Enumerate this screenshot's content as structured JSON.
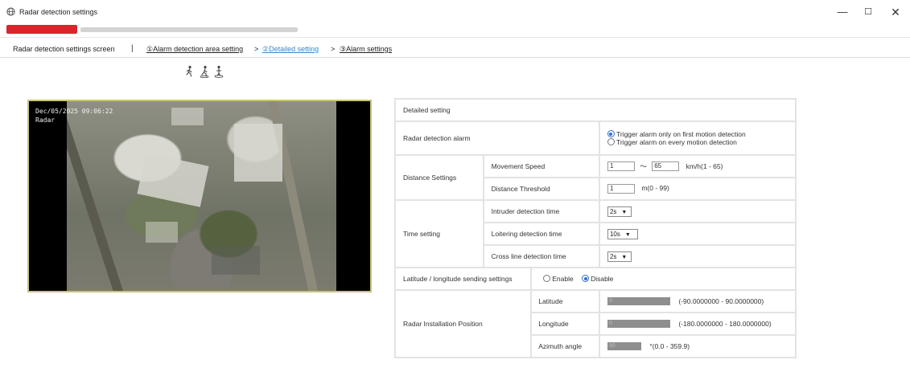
{
  "window": {
    "title": "Radar detection settings",
    "minimize_glyph": "—",
    "maximize_glyph": "☐",
    "close_glyph": "✕"
  },
  "address_bar": {
    "redacted": true
  },
  "breadcrumb": {
    "title": "Radar detection settings screen",
    "separator": "|",
    "steps": [
      {
        "label": "①Alarm detection area setting"
      },
      {
        "label": "②Detailed setting",
        "active": true
      },
      {
        "label": "③Alarm settings"
      }
    ],
    "arrow": ">"
  },
  "mode_icons": [
    "walking-person-icon",
    "walking-person-area-icon",
    "standing-person-icon"
  ],
  "camera": {
    "timestamp": "Dec/05/2025 09:06:22",
    "label": "Radar"
  },
  "detailed": {
    "header": "Detailed setting",
    "radar_alarm": {
      "label": "Radar detection alarm",
      "options": [
        {
          "label": "Trigger alarm only on first motion detection",
          "selected": true
        },
        {
          "label": "Trigger alarm on every motion detection",
          "selected": false
        }
      ]
    },
    "distance": {
      "label": "Distance Settings",
      "movement_speed": {
        "label": "Movement Speed",
        "min": "1",
        "tilde": "～",
        "max": "65",
        "range": "km/h(1 - 65)"
      },
      "distance_threshold": {
        "label": "Distance Threshold",
        "value": "1",
        "range": "m(0 - 99)"
      }
    },
    "time": {
      "label": "Time setting",
      "intruder": {
        "label": "Intruder detection time",
        "value": "2s"
      },
      "loitering": {
        "label": "Loitering detection time",
        "value": "10s"
      },
      "crossline": {
        "label": "Cross line detection time",
        "value": "2s"
      }
    },
    "latlon_send": {
      "label": "Latitude / longitude sending settings",
      "enable": "Enable",
      "disable": "Disable",
      "selected": "Disable"
    },
    "install_pos": {
      "label": "Radar Installation Position",
      "latitude": {
        "label": "Latitude",
        "value": "0",
        "range": "(-90.0000000 - 90.0000000)"
      },
      "longitude": {
        "label": "Longitude",
        "value": "0",
        "range": "(-180.0000000 - 180.0000000)"
      },
      "azimuth": {
        "label": "Azimuth angle",
        "value": "90",
        "range": "°(0.0 - 359.9)"
      }
    }
  },
  "colors": {
    "active_link": "#3a84c7",
    "radio_selected": "#2a6fd4",
    "redaction_red": "#d9262d",
    "camera_border": "#c9c27a"
  }
}
